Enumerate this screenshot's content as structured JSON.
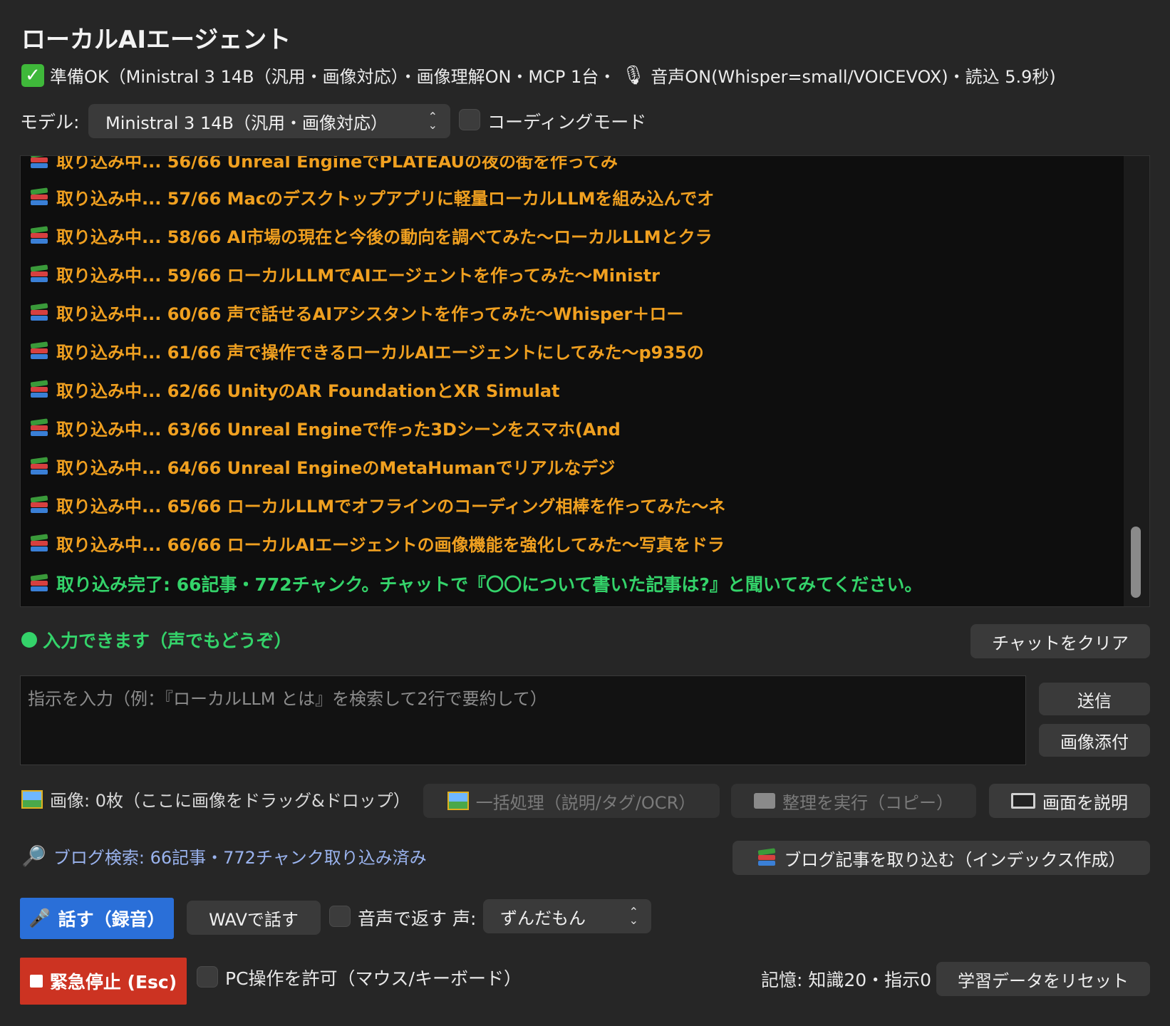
{
  "app": {
    "title": "ローカルAIエージェント",
    "status_text": "準備OK（Ministral 3 14B（汎用・画像対応）・画像理解ON・MCP 1台・",
    "status_voice": "音声ON(Whisper=small/VOICEVOX)・読込 5.9秒)"
  },
  "model": {
    "label": "モデル:",
    "selected": "Ministral 3 14B（汎用・画像対応）",
    "coding_mode_label": "コーディングモード"
  },
  "log": {
    "lines": [
      "取り込み中... 56/66 Unreal EngineでPLATEAUの夜の街を作ってみ",
      "取り込み中... 57/66 Macのデスクトップアプリに軽量ローカルLLMを組み込んでオ",
      "取り込み中... 58/66 AI市場の現在と今後の動向を調べてみた〜ローカルLLMとクラ",
      "取り込み中... 59/66 ローカルLLMでAIエージェントを作ってみた〜Ministr",
      "取り込み中... 60/66 声で話せるAIアシスタントを作ってみた〜Whisper＋ロー",
      "取り込み中... 61/66 声で操作できるローカルAIエージェントにしてみた〜p935の",
      "取り込み中... 62/66 UnityのAR FoundationとXR Simulat",
      "取り込み中... 63/66 Unreal Engineで作った3Dシーンをスマホ(And",
      "取り込み中... 64/66 Unreal EngineのMetaHumanでリアルなデジ",
      "取り込み中... 65/66 ローカルLLMでオフラインのコーディング相棒を作ってみた〜ネ",
      "取り込み中... 66/66 ローカルAIエージェントの画像機能を強化してみた〜写真をドラ"
    ],
    "done_line": "取り込み完了: 66記事・772チャンク。チャットで『〇〇について書いた記事は?』と聞いてみてください。"
  },
  "input_area": {
    "ready_text": "入力できます（声でもどうぞ）",
    "clear_button": "チャットをクリア",
    "placeholder": "指示を入力（例：『ローカルLLM とは』を検索して2行で要約して）",
    "send_button": "送信",
    "attach_button": "画像添付"
  },
  "image_tools": {
    "status": "画像: 0枚（ここに画像をドラッグ&ドロップ）",
    "batch_button": "一括処理（説明/タグ/OCR）",
    "organize_button": "整理を実行（コピー）",
    "explain_screen_button": "画面を説明"
  },
  "blog": {
    "status": "ブログ検索: 66記事・772チャンク取り込み済み",
    "import_button": "ブログ記事を取り込む（インデックス作成）"
  },
  "voice": {
    "talk_button": "話す（録音）",
    "wav_button": "WAVで話す",
    "reply_voice_label": "音声で返す",
    "voice_label": "声:",
    "voice_selected": "ずんだもん"
  },
  "bottom": {
    "stop_button": "緊急停止 (Esc)",
    "pc_control_label": "PC操作を許可（マウス/キーボード）",
    "memory_text": "記憶: 知識20・指示0",
    "reset_button": "学習データをリセット"
  },
  "colors": {
    "background": "#262626",
    "log_progress": "#f0a020",
    "log_done": "#34d36a",
    "talk_button": "#2a6fd8",
    "stop_button": "#cc3322",
    "blog_status": "#9ab3ee"
  }
}
